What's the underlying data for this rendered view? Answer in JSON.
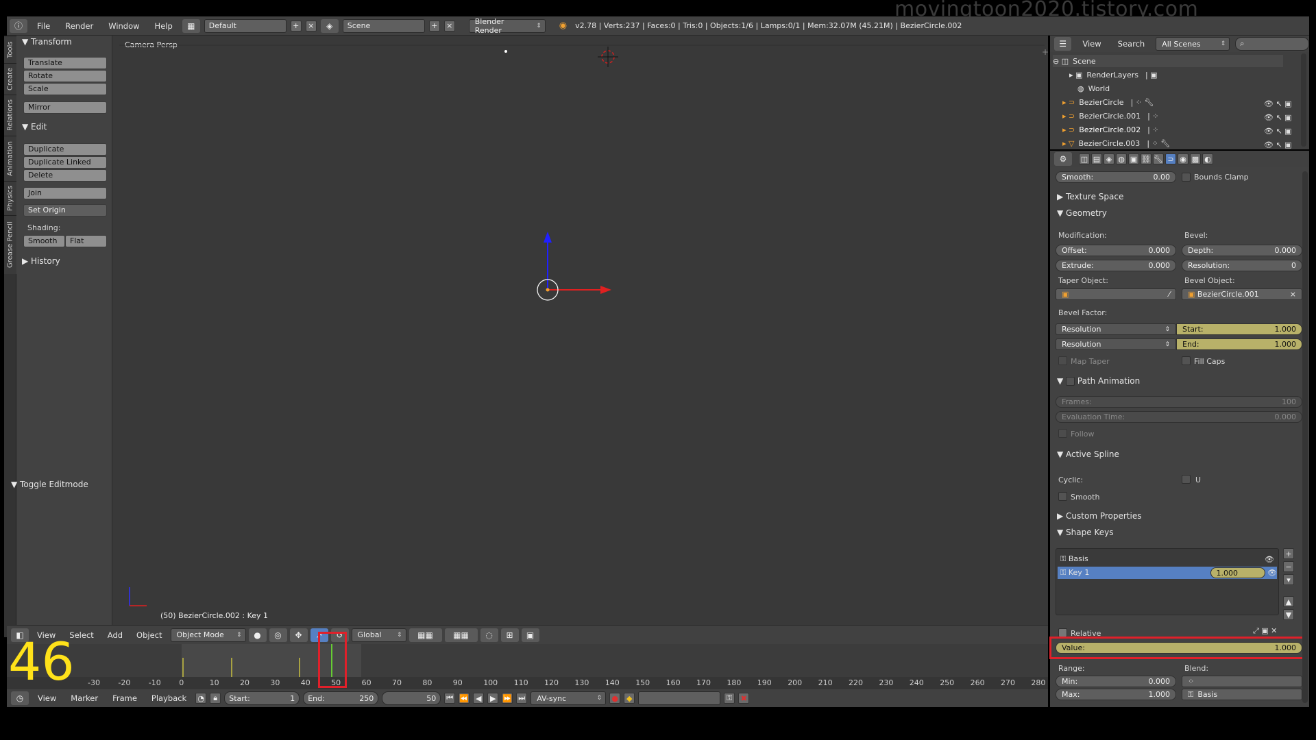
{
  "watermark": "movingtoon2020.tistory.com",
  "info_header": {
    "menus": [
      "File",
      "Render",
      "Window",
      "Help"
    ],
    "layout": "Default",
    "scene": "Scene",
    "engine": "Blender Render",
    "stats": "v2.78 | Verts:237 | Faces:0 | Tris:0 | Objects:1/6 | Lamps:0/1 | Mem:32.07M (45.21M) | BezierCircle.002"
  },
  "left_tabs": [
    "Tools",
    "Create",
    "Relations",
    "Animation",
    "Physics",
    "Grease Pencil"
  ],
  "tool_shelf": {
    "transform_title": "Transform",
    "translate": "Translate",
    "rotate": "Rotate",
    "scale": "Scale",
    "mirror": "Mirror",
    "edit_title": "Edit",
    "duplicate": "Duplicate",
    "duplicate_linked": "Duplicate Linked",
    "delete": "Delete",
    "join": "Join",
    "set_origin": "Set Origin",
    "shading_label": "Shading:",
    "smooth": "Smooth",
    "flat": "Flat",
    "history": "History",
    "toggle_editmode": "Toggle Editmode"
  },
  "viewport": {
    "label": "Camera Persp",
    "status": "(50) BezierCircle.002 : Key 1"
  },
  "viewport_header": {
    "menus": [
      "View",
      "Select",
      "Add",
      "Object"
    ],
    "mode": "Object Mode",
    "orientation": "Global"
  },
  "timeline": {
    "big_number": "46",
    "ticks": [
      "-30",
      "-20",
      "-10",
      "0",
      "10",
      "20",
      "30",
      "40",
      "50",
      "60",
      "70",
      "80",
      "90",
      "100",
      "110",
      "120",
      "130",
      "140",
      "150",
      "160",
      "170",
      "180",
      "190",
      "200",
      "210",
      "220",
      "230",
      "240",
      "250",
      "260",
      "270",
      "280"
    ],
    "menus": [
      "View",
      "Marker",
      "Frame",
      "Playback"
    ],
    "start_label": "Start:",
    "start_value": "1",
    "end_label": "End:",
    "end_value": "250",
    "current_frame": "50",
    "sync": "AV-sync"
  },
  "outliner": {
    "menus": [
      "View",
      "Search"
    ],
    "filter": "All Scenes",
    "items": [
      "Scene",
      "RenderLayers",
      "World",
      "BezierCircle",
      "BezierCircle.001",
      "BezierCircle.002",
      "BezierCircle.003"
    ]
  },
  "properties": {
    "smooth_label": "Smooth:",
    "smooth_value": "0.00",
    "bounds_clamp": "Bounds Clamp",
    "texture_space": "Texture Space",
    "geometry": "Geometry",
    "modification": "Modification:",
    "bevel": "Bevel:",
    "offset_label": "Offset:",
    "offset_value": "0.000",
    "depth_label": "Depth:",
    "depth_value": "0.000",
    "extrude_label": "Extrude:",
    "extrude_value": "0.000",
    "resolution_label": "Resolution:",
    "resolution_value": "0",
    "taper_object": "Taper Object:",
    "bevel_object": "Bevel Object:",
    "bevel_object_value": "BezierCircle.001",
    "bevel_factor": "Bevel Factor:",
    "res1": "Resolution",
    "res2": "Resolution",
    "start_label": "Start:",
    "start_value": "1.000",
    "end_label": "End:",
    "end_value": "1.000",
    "map_taper": "Map Taper",
    "fill_caps": "Fill Caps",
    "path_animation": "Path Animation",
    "frames_label": "Frames:",
    "frames_value": "100",
    "eval_label": "Evaluation Time:",
    "eval_value": "0.000",
    "follow": "Follow",
    "active_spline": "Active Spline",
    "cyclic": "Cyclic:",
    "cyclic_u": "U",
    "smooth2": "Smooth",
    "custom_props": "Custom Properties",
    "shape_keys": "Shape Keys",
    "key_basis": "Basis",
    "key1": "Key 1",
    "key1_value": "1.000",
    "relative": "Relative",
    "value_label": "Value:",
    "value_value": "1.000",
    "range": "Range:",
    "blend": "Blend:",
    "min_label": "Min:",
    "min_value": "0.000",
    "max_label": "Max:",
    "max_value": "1.000",
    "blend_value": "Basis"
  },
  "colors": {
    "highlight": "#e0202a",
    "annotation": "#ffe21a",
    "selected": "#5680c2",
    "slider": "#b8b169"
  }
}
